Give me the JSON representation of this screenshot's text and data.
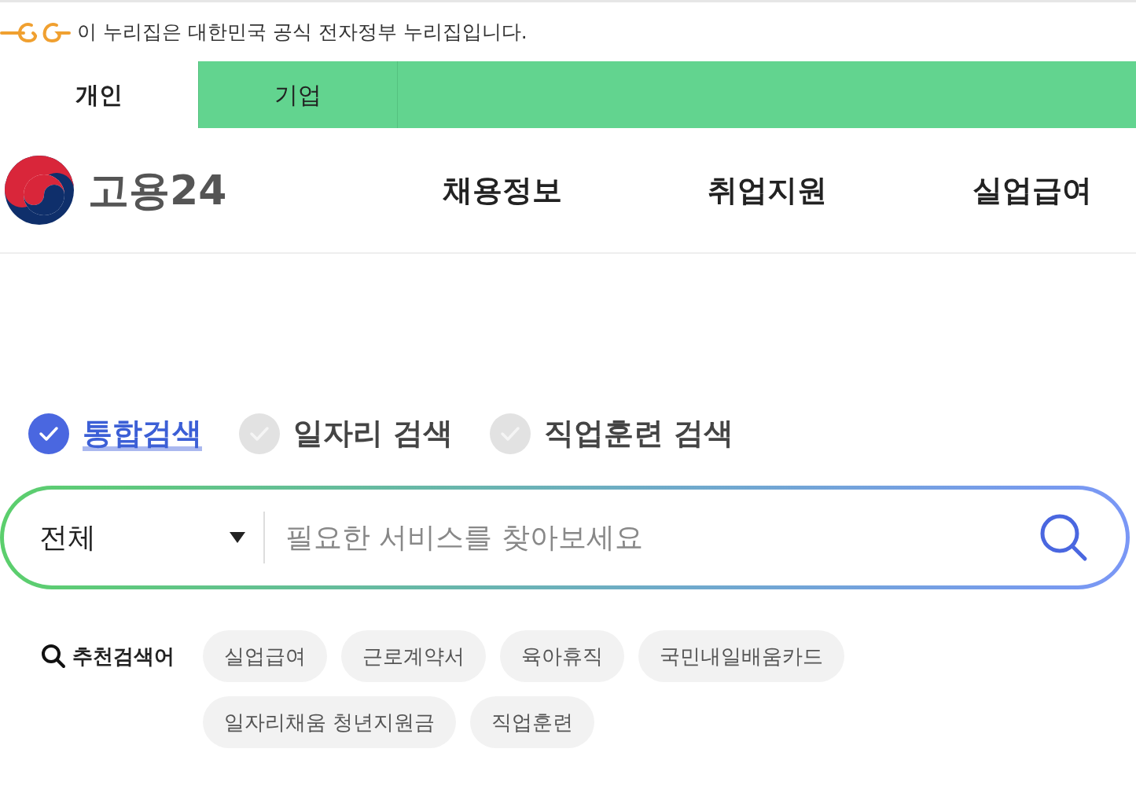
{
  "notice": {
    "text": "이 누리집은 대한민국 공식 전자정부 누리집입니다."
  },
  "user_tabs": [
    {
      "label": "개인",
      "selected": true
    },
    {
      "label": "기업",
      "selected": false
    }
  ],
  "site": {
    "name": "고용24"
  },
  "nav": [
    {
      "label": "채용정보"
    },
    {
      "label": "취업지원"
    },
    {
      "label": "실업급여"
    }
  ],
  "search_types": [
    {
      "label": "통합검색",
      "selected": true
    },
    {
      "label": "일자리 검색",
      "selected": false
    },
    {
      "label": "직업훈련 검색",
      "selected": false
    }
  ],
  "search": {
    "category": "전체",
    "placeholder": "필요한 서비스를 찾아보세요"
  },
  "recommended": {
    "label": "추천검색어",
    "keywords": [
      "실업급여",
      "근로계약서",
      "육아휴직",
      "국민내일배움카드",
      "일자리채움 청년지원금",
      "직업훈련"
    ]
  }
}
